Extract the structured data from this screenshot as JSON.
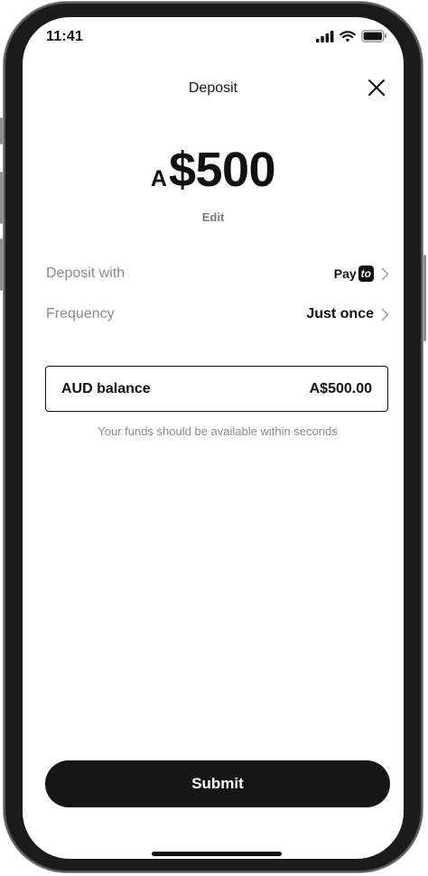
{
  "status_bar": {
    "time": "11:41"
  },
  "header": {
    "title": "Deposit",
    "close_icon": "close-icon"
  },
  "amount": {
    "currency": "A",
    "value": "$500",
    "edit_label": "Edit"
  },
  "rows": {
    "deposit_with": {
      "label": "Deposit with",
      "method_text": "Pay",
      "method_badge": "to"
    },
    "frequency": {
      "label": "Frequency",
      "value": "Just once"
    }
  },
  "balance": {
    "label": "AUD balance",
    "amount": "A$500.00"
  },
  "info": {
    "text": "Your funds should be available within seconds"
  },
  "actions": {
    "submit_label": "Submit"
  },
  "colors": {
    "primary": "#161616",
    "muted_text": "#8a8a8a",
    "background": "#ffffff"
  }
}
